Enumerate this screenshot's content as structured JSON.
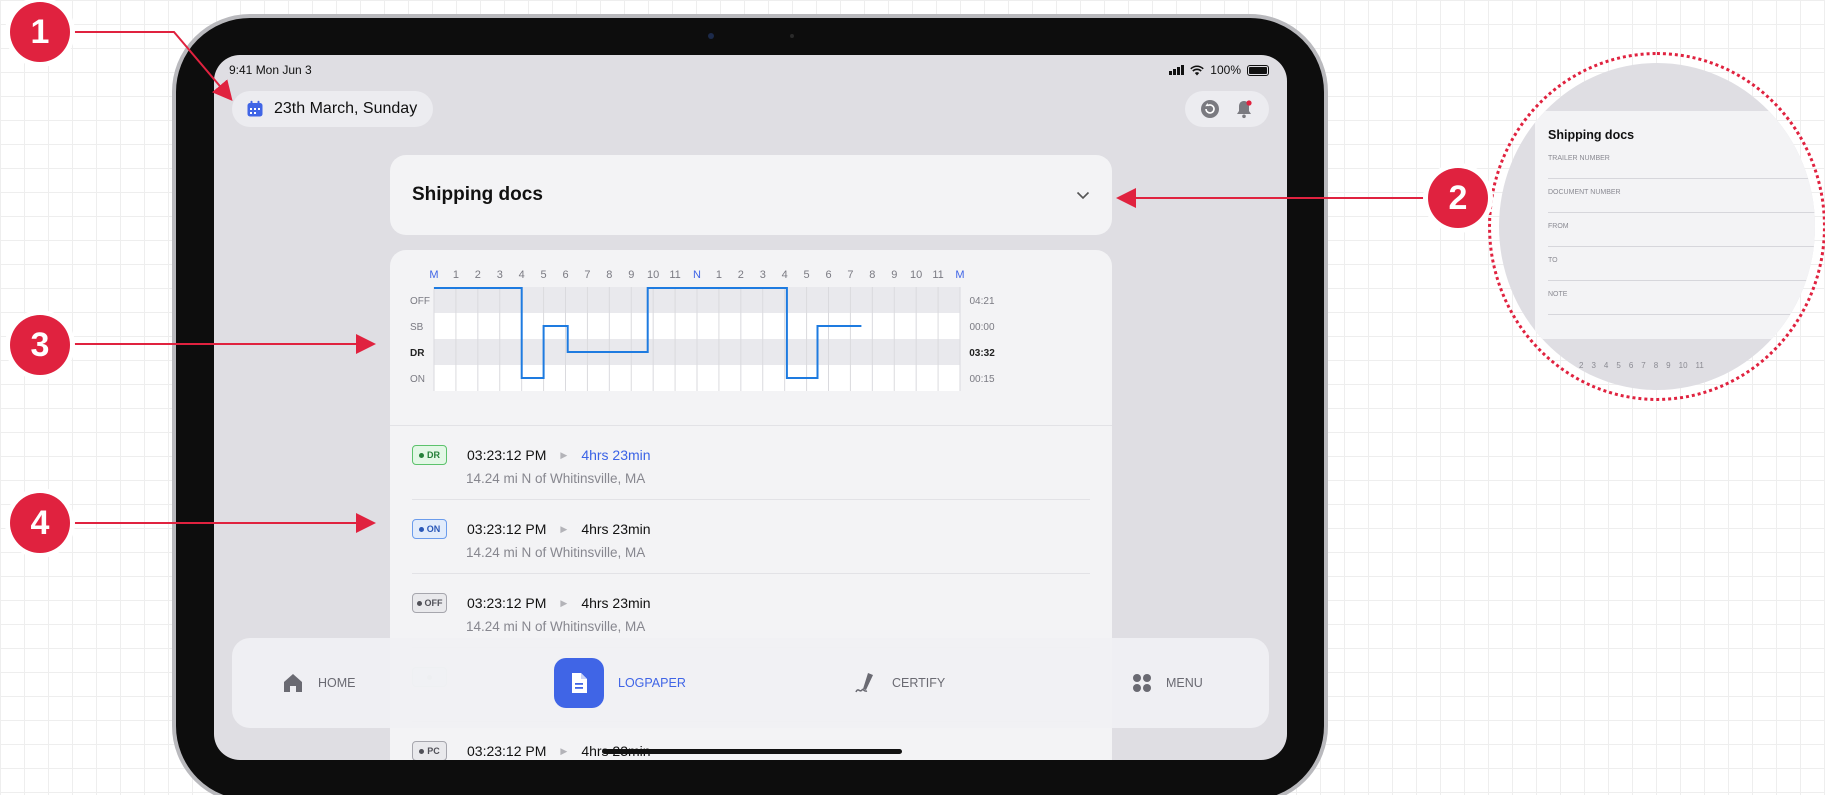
{
  "status_bar": {
    "time_date": "9:41 Mon Jun 3",
    "battery": "100%"
  },
  "header": {
    "date": "23th March, Sunday"
  },
  "shipping_docs": {
    "title": "Shipping docs"
  },
  "chart_data": {
    "type": "line",
    "hour_labels": [
      "M",
      "1",
      "2",
      "3",
      "4",
      "5",
      "6",
      "7",
      "8",
      "9",
      "10",
      "11",
      "N",
      "1",
      "2",
      "3",
      "4",
      "5",
      "6",
      "7",
      "8",
      "9",
      "10",
      "11",
      "M"
    ],
    "rows": [
      "OFF",
      "SB",
      "DR",
      "ON"
    ],
    "totals": [
      "04:21",
      "00:00",
      "03:32",
      "00:15"
    ],
    "status_line": [
      {
        "hour": 0,
        "status": "OFF"
      },
      {
        "hour": 4,
        "status": "OFF"
      },
      {
        "hour": 4,
        "status": "ON"
      },
      {
        "hour": 5,
        "status": "ON"
      },
      {
        "hour": 5,
        "status": "SB"
      },
      {
        "hour": 6.1,
        "status": "SB"
      },
      {
        "hour": 6.1,
        "status": "DR"
      },
      {
        "hour": 9.75,
        "status": "DR"
      },
      {
        "hour": 9.75,
        "status": "OFF"
      },
      {
        "hour": 16.1,
        "status": "OFF"
      },
      {
        "hour": 16.1,
        "status": "ON"
      },
      {
        "hour": 17.5,
        "status": "ON"
      },
      {
        "hour": 17.5,
        "status": "SB"
      },
      {
        "hour": 19.5,
        "status": "SB"
      }
    ]
  },
  "events": [
    {
      "badge": "DR",
      "time": "03:23:12 PM",
      "duration": "4hrs 23min",
      "location": "14.24 mi N of Whitinsville, MA"
    },
    {
      "badge": "ON",
      "time": "03:23:12 PM",
      "duration": "4hrs 23min",
      "location": "14.24 mi N of Whitinsville, MA"
    },
    {
      "badge": "OFF",
      "time": "03:23:12 PM",
      "duration": "4hrs 23min",
      "location": "14.24 mi N of Whitinsville, MA"
    },
    {
      "badge": "",
      "time": "",
      "duration": "",
      "location": ""
    },
    {
      "badge": "PC",
      "time": "03:23:12 PM",
      "duration": "4hrs 23min",
      "location": ""
    }
  ],
  "nav": {
    "home": "HOME",
    "logpaper": "LOGPAPER",
    "certify": "CERTIFY",
    "menu": "MENU"
  },
  "zoom_panel": {
    "title": "Shipping docs",
    "fields": [
      "TRAILER NUMBER",
      "DOCUMENT NUMBER",
      "FROM",
      "TO",
      "NOTE"
    ],
    "ticks": [
      "2",
      "3",
      "4",
      "5",
      "6",
      "7",
      "8",
      "9",
      "10",
      "11"
    ]
  },
  "callouts": [
    "1",
    "2",
    "3",
    "4"
  ],
  "colors": {
    "accent": "#4065e6",
    "callout": "#e0223f",
    "chart_line": "#1e7be0"
  }
}
